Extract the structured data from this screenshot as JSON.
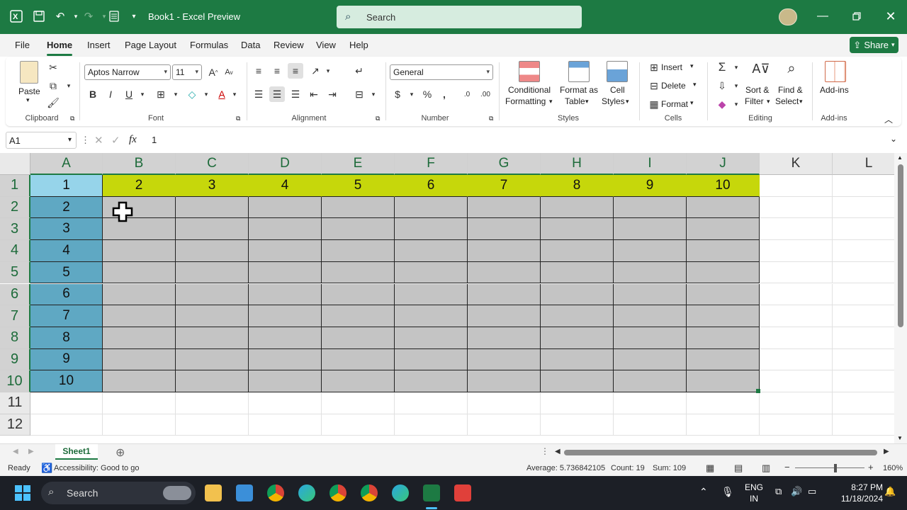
{
  "app": {
    "title": "Book1  -  Excel Preview",
    "search_placeholder": "Search"
  },
  "menu": {
    "items": [
      "File",
      "Home",
      "Insert",
      "Page Layout",
      "Formulas",
      "Data",
      "Review",
      "View",
      "Help"
    ],
    "active": "Home",
    "share_label": "Share"
  },
  "ribbon": {
    "clipboard": {
      "label": "Clipboard",
      "paste": "Paste"
    },
    "font": {
      "label": "Font",
      "name": "Aptos Narrow",
      "size": "11"
    },
    "alignment": {
      "label": "Alignment"
    },
    "number": {
      "label": "Number",
      "format": "General"
    },
    "styles": {
      "label": "Styles",
      "conditional": [
        "Conditional",
        "Formatting"
      ],
      "format_as_table": [
        "Format as",
        "Table"
      ],
      "cell_styles": [
        "Cell",
        "Styles"
      ]
    },
    "cells": {
      "label": "Cells",
      "insert": "Insert",
      "delete": "Delete",
      "format": "Format"
    },
    "editing": {
      "label": "Editing",
      "sort": [
        "Sort &",
        "Filter"
      ],
      "find": [
        "Find &",
        "Select"
      ]
    },
    "addins": {
      "label": "Add-ins",
      "button": "Add-ins"
    }
  },
  "formula_bar": {
    "name_box": "A1",
    "fx": "fx",
    "value": "1"
  },
  "grid": {
    "columns": [
      "A",
      "B",
      "C",
      "D",
      "E",
      "F",
      "G",
      "H",
      "I",
      "J",
      "K",
      "L"
    ],
    "rows": [
      "1",
      "2",
      "3",
      "4",
      "5",
      "6",
      "7",
      "8",
      "9",
      "10",
      "11",
      "12"
    ],
    "row1_values": [
      "1",
      "2",
      "3",
      "4",
      "5",
      "6",
      "7",
      "8",
      "9",
      "10"
    ],
    "colA_values": [
      "2",
      "3",
      "4",
      "5",
      "6",
      "7",
      "8",
      "9",
      "10"
    ],
    "colors": {
      "header_fill": "#c6d70b",
      "first_col_fill": "#5fa8c3",
      "body_fill": "#c4c4c4",
      "active_fill": "#96d4ea"
    }
  },
  "sheets": {
    "tabs": [
      "Sheet1"
    ]
  },
  "status": {
    "ready": "Ready",
    "accessibility": "Accessibility: Good to go",
    "average": "Average: 5.736842105",
    "count": "Count: 19",
    "sum": "Sum: 109",
    "zoom": "160%"
  },
  "taskbar": {
    "search": "Search",
    "lang_line1": "ENG",
    "lang_line2": "IN",
    "time": "8:27 PM",
    "date": "11/18/2024"
  }
}
